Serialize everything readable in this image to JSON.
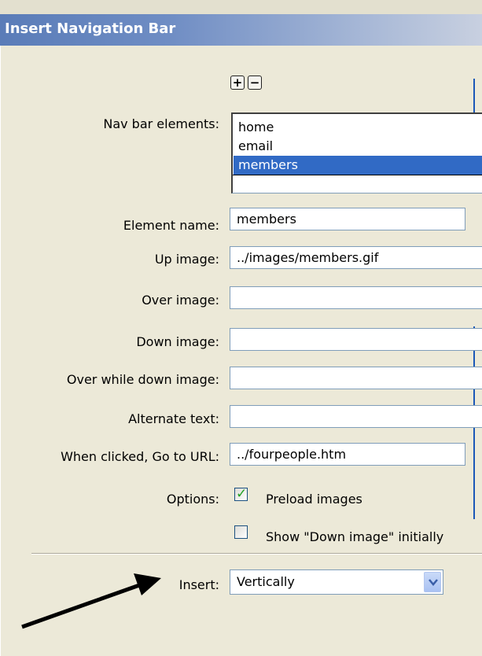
{
  "window": {
    "top_fragment": "",
    "title": "Insert Navigation Bar"
  },
  "toolbar": {
    "add_icon": "plus-icon",
    "remove_icon": "minus-icon",
    "add_label": "+",
    "remove_label": "−"
  },
  "nav": {
    "label": "Nav bar elements:",
    "items": [
      "home",
      "email",
      "members"
    ],
    "selected_index": 2
  },
  "fields": {
    "element_name": {
      "label": "Element name:",
      "value": "members"
    },
    "up_image": {
      "label": "Up image:",
      "value": "../images/members.gif"
    },
    "over_image": {
      "label": "Over image:",
      "value": ""
    },
    "down_image": {
      "label": "Down image:",
      "value": ""
    },
    "over_while_down": {
      "label": "Over while down image:",
      "value": ""
    },
    "alt_text": {
      "label": "Alternate text:",
      "value": ""
    },
    "url": {
      "label": "When clicked, Go to URL:",
      "value": "../fourpeople.htm"
    }
  },
  "options": {
    "label": "Options:",
    "preload": {
      "label": "Preload images",
      "checked": true,
      "mark": "✓"
    },
    "show_down": {
      "label": "Show \"Down image\" initially",
      "checked": false
    }
  },
  "insert": {
    "label": "Insert:",
    "value": "Vertically"
  },
  "colors": {
    "dialog_bg": "#ece9d8",
    "title_gradient_start": "#5a7cb8",
    "selection": "#316ac5",
    "checkmark": "#21a121",
    "field_border": "#7f9db9"
  },
  "icons": {
    "dropdown": "chevron-down-icon",
    "annotation": "arrow-icon"
  }
}
